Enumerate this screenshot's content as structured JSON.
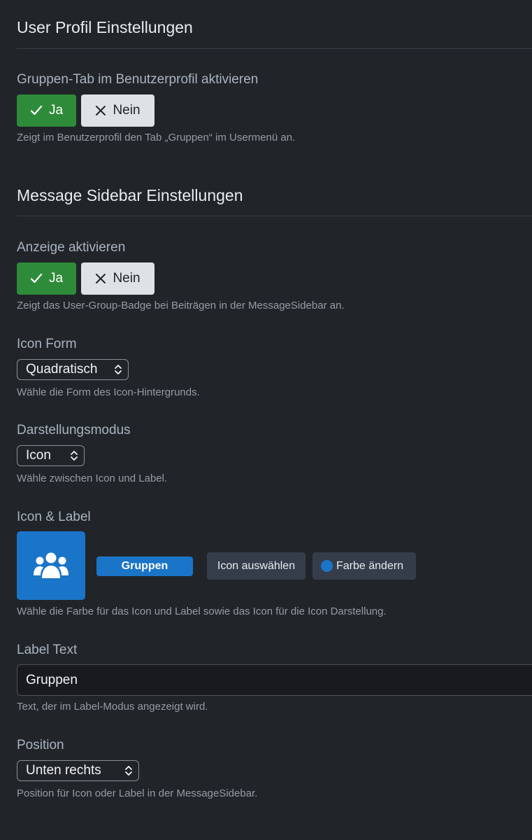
{
  "user_profile": {
    "title": "User Profil Einstellungen",
    "group_tab": {
      "label": "Gruppen-Tab im Benutzerprofil aktivieren",
      "yes": "Ja",
      "no": "Nein",
      "selected": "yes",
      "help": "Zeigt im Benutzerprofil den Tab „Gruppen“ im Usermenü an."
    }
  },
  "message_sidebar": {
    "title": "Message Sidebar Einstellungen",
    "display": {
      "label": "Anzeige aktivieren",
      "yes": "Ja",
      "no": "Nein",
      "selected": "yes",
      "help": "Zeigt das User-Group-Badge bei Beiträgen in der MessageSidebar an."
    },
    "icon_form": {
      "label": "Icon Form",
      "value": "Quadratisch",
      "help": "Wähle die Form des Icon-Hintergrunds."
    },
    "display_mode": {
      "label": "Darstellungsmodus",
      "value": "Icon",
      "help": "Wähle zwischen Icon und Label."
    },
    "icon_label": {
      "label": "Icon & Label",
      "preview_icon": "users-icon",
      "preview_label": "Gruppen",
      "choose_icon_button": "Icon auswählen",
      "change_color_button": "Farbe ändern",
      "color": "#1a75c8",
      "help": "Wähle die Farbe für das Icon und Label sowie das Icon für die Icon Darstellung."
    },
    "label_text": {
      "label": "Label Text",
      "value": "Gruppen",
      "help": "Text, der im Label-Modus angezeigt wird."
    },
    "position": {
      "label": "Position",
      "value": "Unten rechts",
      "help": "Position für Icon oder Label in der MessageSidebar."
    }
  }
}
